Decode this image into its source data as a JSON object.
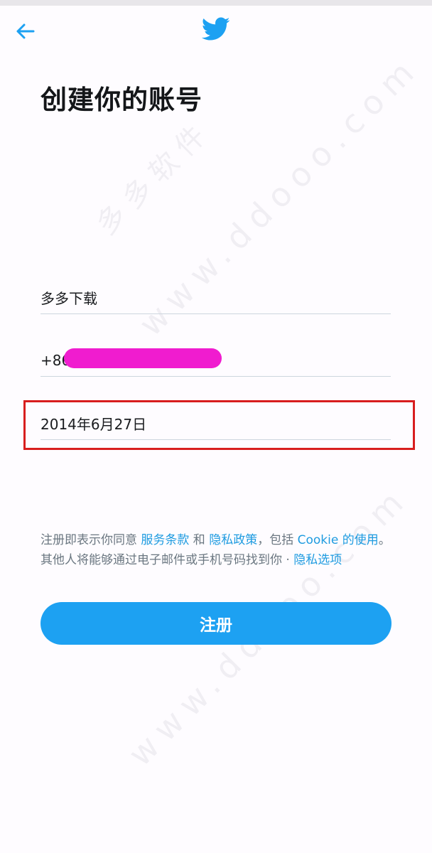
{
  "header": {
    "back_icon": "arrow-left-icon",
    "logo_icon": "twitter-bird-icon"
  },
  "title": "创建你的账号",
  "form": {
    "name_value": "多多下载",
    "phone_prefix": "+86",
    "birthday_value": "2014年6月27日"
  },
  "terms": {
    "text1": "注册即表示你同意 ",
    "link1": "服务条款",
    "text2": " 和 ",
    "link2": "隐私政策",
    "text3": "，包括 ",
    "link3": "Cookie 的使用",
    "text4": "。其他人将能够通过电子邮件或手机号码找到你 · ",
    "link4": "隐私选项"
  },
  "signup_label": "注册",
  "watermark": "www.ddooo.com",
  "watermark_cn": "多多软件",
  "colors": {
    "accent": "#1da1f2",
    "link": "#1e9be0",
    "highlight": "#d81e1e",
    "redaction": "#f01ccf"
  }
}
